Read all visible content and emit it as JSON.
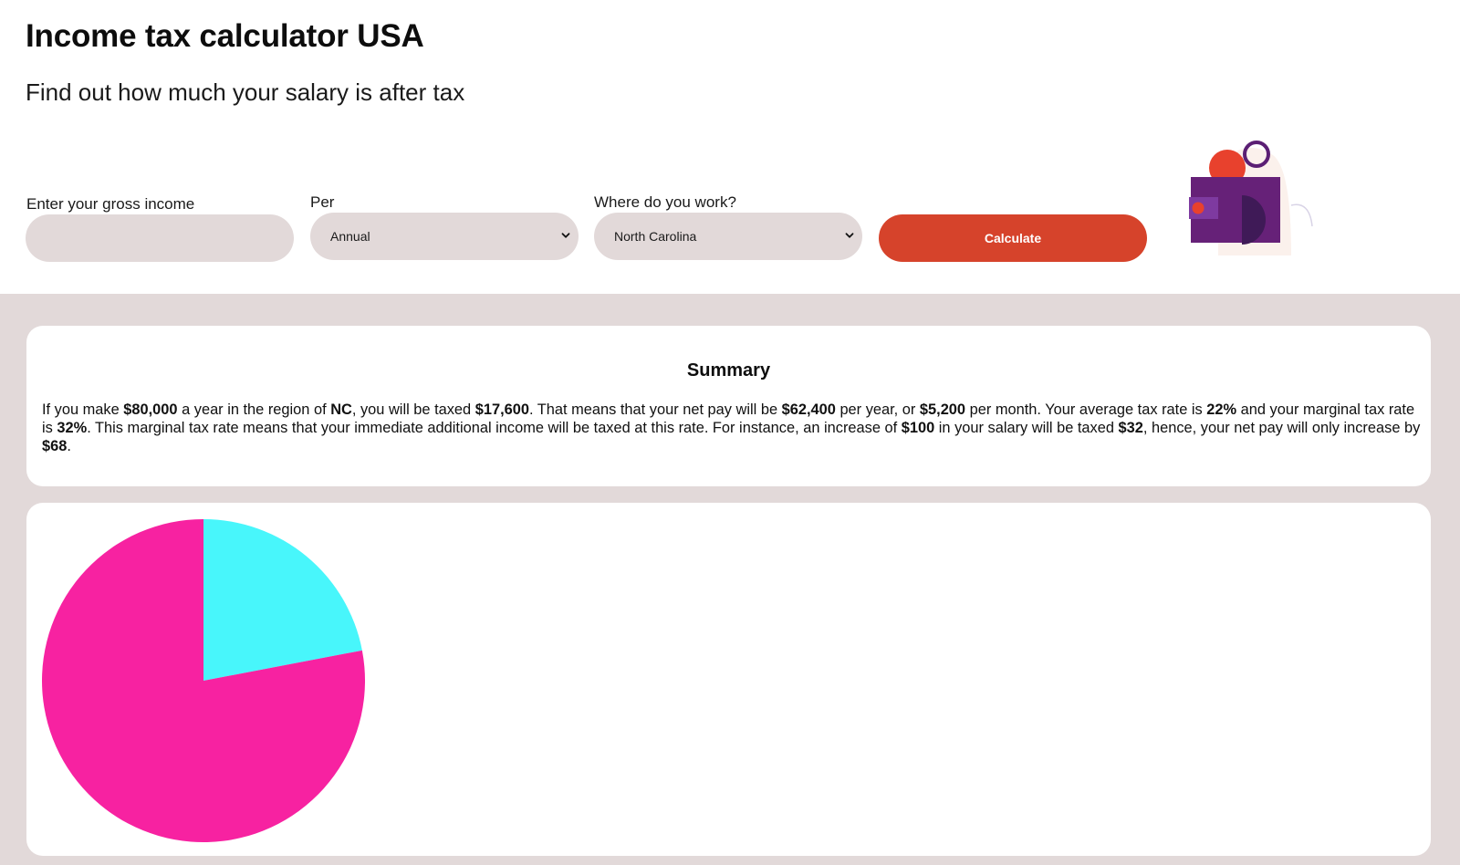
{
  "header": {
    "title": "Income tax calculator USA",
    "subtitle": "Find out how much your salary is after tax"
  },
  "form": {
    "income_label": "Enter your gross income",
    "income_value": "",
    "income_placeholder": "",
    "per_label": "Per",
    "per_selected": "Annual",
    "region_label": "Where do you work?",
    "region_selected": "North Carolina",
    "calculate_label": "Calculate"
  },
  "summary": {
    "title": "Summary",
    "t1": "If you make ",
    "salary": "$80,000",
    "t2": " a year in the region of ",
    "region": "NC",
    "t3": ", you will be taxed ",
    "tax": "$17,600",
    "t4": ". That means that your net pay will be ",
    "net_year": "$62,400",
    "t5": " per year, or ",
    "net_month": "$5,200",
    "t6": " per month. Your average tax rate is ",
    "avg_rate": "22%",
    "t7": " and your marginal tax rate is ",
    "marginal_rate": "32%",
    "t8": ". This marginal tax rate means that your immediate additional income will be taxed at this rate. For instance, an increase of ",
    "increase": "$100",
    "t9": " in your salary will be taxed ",
    "increase_tax": "$32",
    "t10": ", hence, your net pay will only increase by ",
    "increase_net": "$68",
    "t11": "."
  },
  "chart_data": {
    "type": "pie",
    "title": "",
    "categories": [
      "",
      ""
    ],
    "values": [
      17600,
      62400
    ],
    "colors": [
      "#48f6fb",
      "#f722a1"
    ],
    "legend": "none"
  },
  "colors": {
    "accent": "#d6432b",
    "field_bg": "#e2d9d9",
    "page_bg": "#e2d9d9",
    "illustration_purple": "#662178",
    "illustration_dark": "#3f1a57"
  },
  "icons": {
    "select_chevron": "chevron-down-icon",
    "illustration": "wallet-illustration"
  }
}
